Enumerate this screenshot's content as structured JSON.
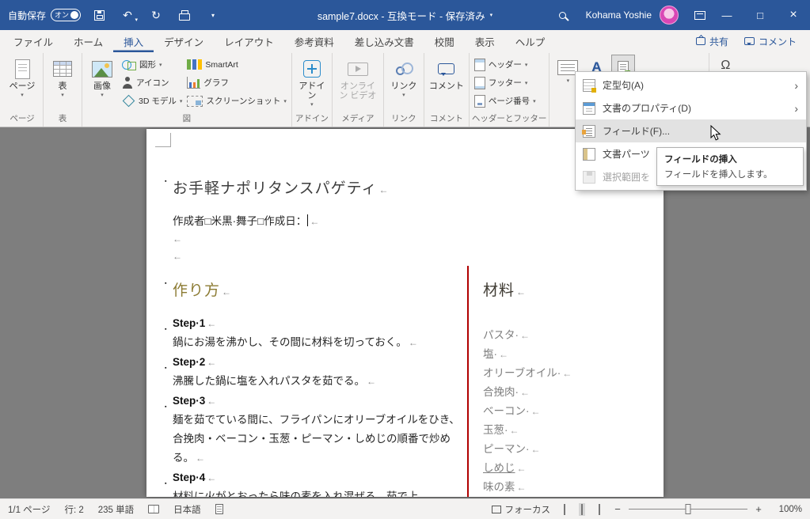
{
  "colors": {
    "accent": "#2b579a",
    "heading": "#8c7b33",
    "rule": "#b00000",
    "ing": "#7f7f7f"
  },
  "icons": {
    "chevron": "▾",
    "submenu": "›",
    "undo": "↶",
    "redo": "↻",
    "omega": "Ω",
    "bullet": "▪",
    "minimize": "—",
    "maximize": "□",
    "close": "×",
    "wordart_a": "A"
  },
  "titlebar": {
    "autosave_label": "自動保存",
    "autosave_state": "オン",
    "title": "sample7.docx - 互換モード - 保存済み",
    "user_name": "Kohama Yoshie"
  },
  "tabs": {
    "items": [
      "ファイル",
      "ホーム",
      "挿入",
      "デザイン",
      "レイアウト",
      "参考資料",
      "差し込み文書",
      "校閲",
      "表示",
      "ヘルプ"
    ],
    "share": "共有",
    "comments": "コメント"
  },
  "ribbon": {
    "pages": {
      "button": "ページ",
      "group": "ページ"
    },
    "table": {
      "button": "表",
      "group": "表"
    },
    "illustrations": {
      "group": "図",
      "picture": "画像",
      "shapes": "図形",
      "icons": "アイコン",
      "model3d": "3D モデル",
      "smartart": "SmartArt",
      "chart": "グラフ",
      "screenshot": "スクリーンショット"
    },
    "addins": {
      "button": "アドイン",
      "group": "アドイン"
    },
    "media": {
      "group": "メディア",
      "online_video": "オンライン ビデオ"
    },
    "links": {
      "button": "リンク",
      "group": "リンク"
    },
    "comments": {
      "button": "コメント",
      "group": "コメント"
    },
    "header_footer": {
      "group": "ヘッダーとフッター",
      "header": "ヘッダー",
      "footer": "フッター",
      "page_number": "ページ番号"
    }
  },
  "quickparts_menu": {
    "items": [
      {
        "label": "定型句(A)"
      },
      {
        "label": "文書のプロパティ(D)"
      },
      {
        "label": "フィールド(F)..."
      },
      {
        "label": "文書パーツ"
      },
      {
        "label": "選択範囲を"
      }
    ],
    "tooltip": {
      "title": "フィールドの挿入",
      "body": "フィールドを挿入します。"
    }
  },
  "document": {
    "title": "お手軽ナポリタンスパゲティ",
    "byline": "作成者□米黒·舞子□作成日：",
    "pilcrow": "←",
    "steps_heading": "作り方",
    "steps": [
      {
        "label": "Step·1",
        "text": "鍋にお湯を沸かし、その間に材料を切っておく。"
      },
      {
        "label": "Step·2",
        "text": "沸騰した鍋に塩を入れパスタを茹でる。"
      },
      {
        "label": "Step·3",
        "text": "麺を茹でている間に、フライパンにオリーブオイルをひき、合挽肉・ベーコン・玉葱・ピーマン・しめじの順番で炒める。"
      },
      {
        "label": "Step·4",
        "text": "材料に火がとおったら味の素を入れ混ぜる。茹で上"
      }
    ],
    "ingredients_heading": "材料",
    "ingredients": [
      "パスタ·",
      "塩·",
      "オリーブオイル·",
      "合挽肉·",
      "ベーコン·",
      "玉葱·",
      "ピーマン·",
      "しめじ",
      "味の素"
    ]
  },
  "statusbar": {
    "page": "1/1 ページ",
    "line": "行: 2",
    "words": "235 単語",
    "language": "日本語",
    "focus": "フォーカス",
    "zoom": "100%"
  }
}
